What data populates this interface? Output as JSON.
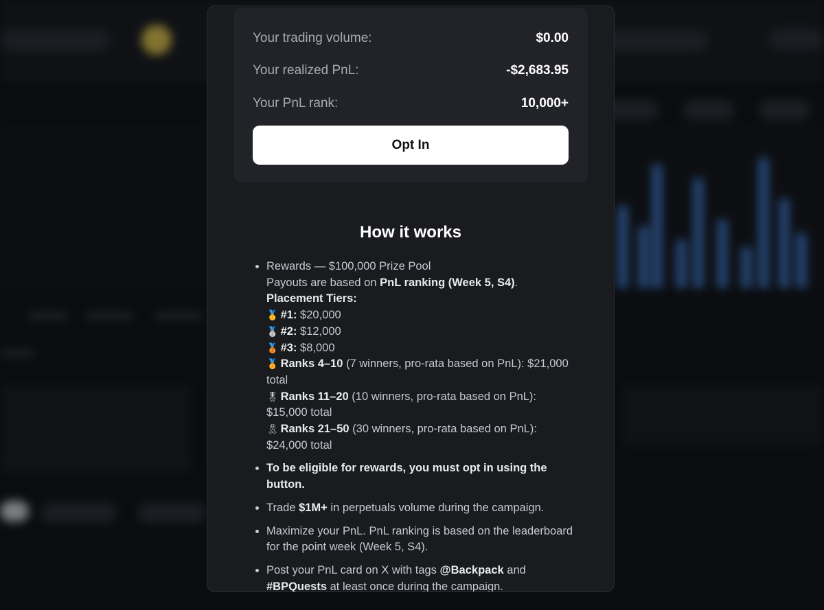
{
  "stats": {
    "volume_label": "Your trading volume:",
    "volume_value": "$0.00",
    "pnl_label": "Your realized PnL:",
    "pnl_value": "-$2,683.95",
    "rank_label": "Your PnL rank:",
    "rank_value": "10,000+"
  },
  "opt_in_button": "Opt In",
  "how_it_works": {
    "title": "How it works",
    "rewards": {
      "line1": "Rewards — $100,000 Prize Pool",
      "payouts_prefix": "Payouts are based on ",
      "payouts_bold": "PnL ranking (Week 5, S4)",
      "payouts_suffix": ".",
      "tiers_heading": "Placement Tiers:",
      "tiers": [
        {
          "icon": "🥇",
          "label": "#1:",
          "text": " $20,000"
        },
        {
          "icon": "🥈",
          "label": "#2:",
          "text": " $12,000"
        },
        {
          "icon": "🥉",
          "label": "#3:",
          "text": " $8,000"
        },
        {
          "icon": "🏅",
          "label": "Ranks 4–10",
          "text": " (7 winners, pro-rata based on PnL): $21,000 total"
        },
        {
          "icon": "🎖",
          "label": "Ranks 11–20",
          "text": " (10 winners, pro-rata based on PnL): $15,000 total"
        },
        {
          "icon": "🎗",
          "label": "Ranks 21–50",
          "text": " (30 winners, pro-rata based on PnL): $24,000 total"
        }
      ]
    },
    "eligibility": "To be eligible for rewards, you must opt in using the button.",
    "trade_prefix": "Trade ",
    "trade_bold": "$1M+",
    "trade_suffix": " in perpetuals volume during the campaign.",
    "maximize": "Maximize your PnL. PnL ranking is based on the leaderboard for the point week (Week 5, S4).",
    "post_prefix": "Post your PnL card on X with tags ",
    "post_tag1": "@Backpack",
    "post_mid": " and ",
    "post_tag2": "#BPQuests",
    "post_suffix": " at least once during the campaign."
  }
}
